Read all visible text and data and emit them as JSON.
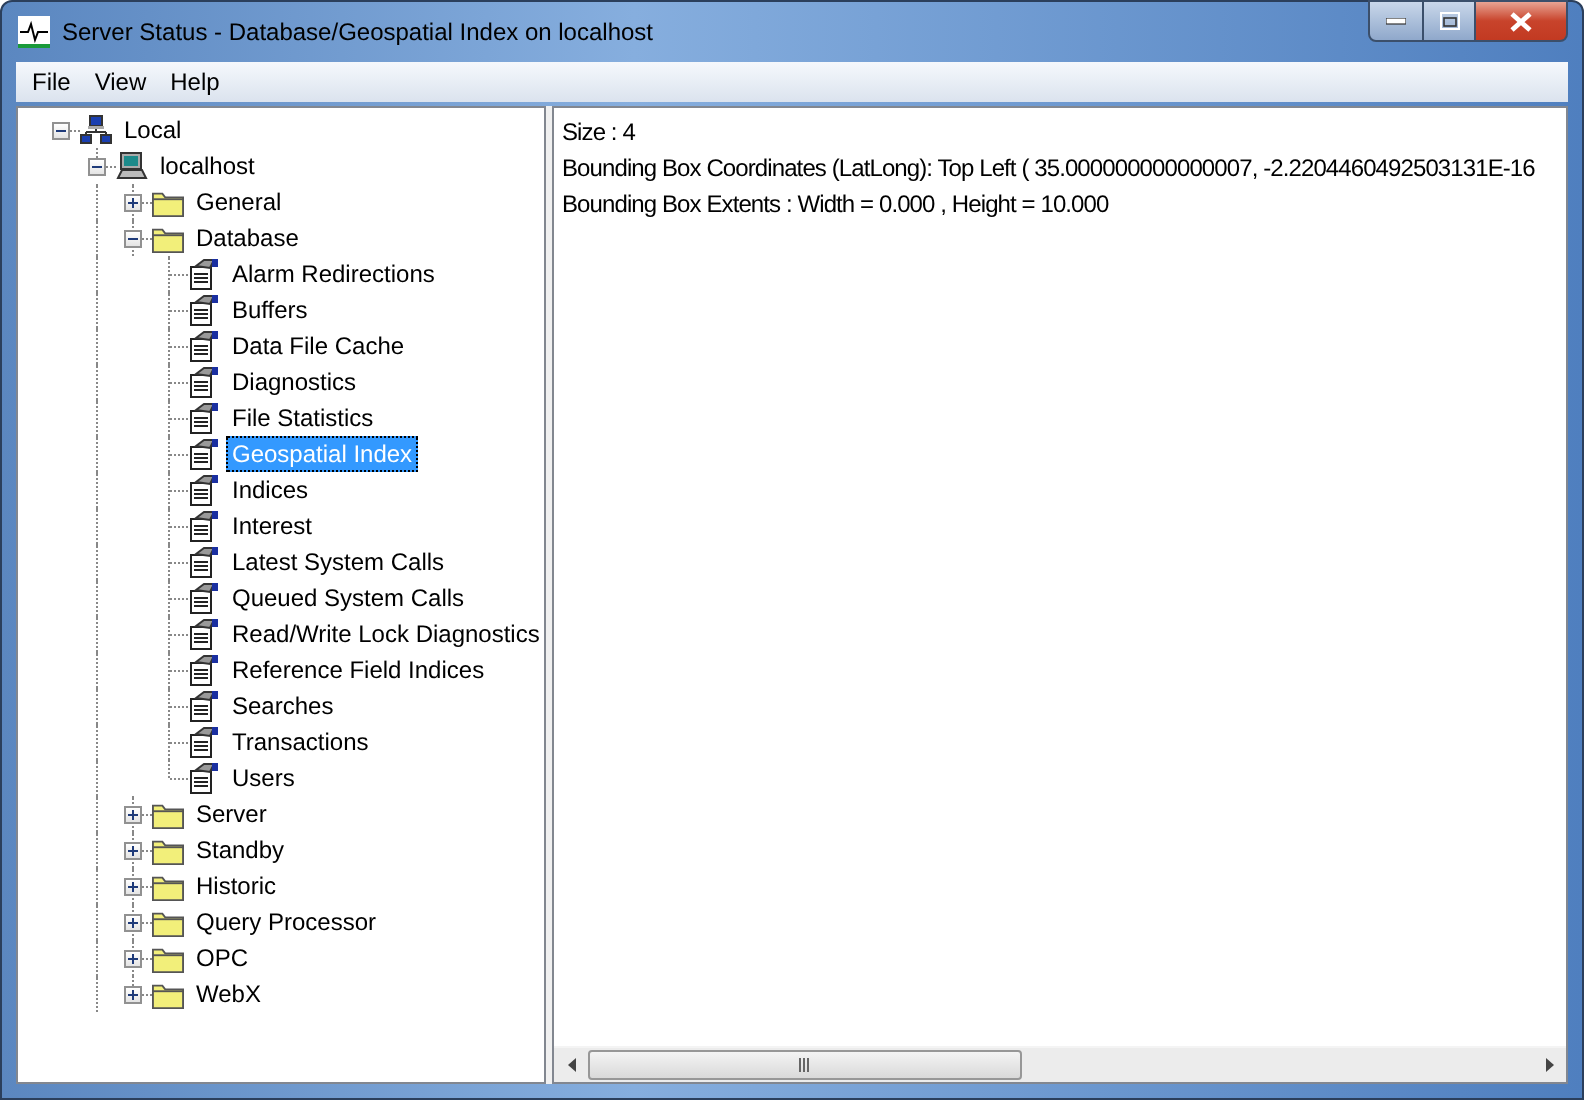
{
  "window": {
    "title": "Server Status - Database/Geospatial Index on localhost"
  },
  "menu": [
    {
      "label": "File"
    },
    {
      "label": "View"
    },
    {
      "label": "Help"
    }
  ],
  "tree": [
    {
      "label": "Local",
      "kind": "network",
      "expanded": true,
      "selected": false,
      "children": [
        {
          "label": "localhost",
          "kind": "computer",
          "expanded": true,
          "selected": false,
          "children": [
            {
              "label": "General",
              "kind": "folder",
              "expanded": false,
              "selected": false
            },
            {
              "label": "Database",
              "kind": "folder",
              "expanded": true,
              "selected": false,
              "children": [
                {
                  "label": "Alarm Redirections",
                  "kind": "page",
                  "selected": false
                },
                {
                  "label": "Buffers",
                  "kind": "page",
                  "selected": false
                },
                {
                  "label": "Data File Cache",
                  "kind": "page",
                  "selected": false
                },
                {
                  "label": "Diagnostics",
                  "kind": "page",
                  "selected": false
                },
                {
                  "label": "File Statistics",
                  "kind": "page",
                  "selected": false
                },
                {
                  "label": "Geospatial Index",
                  "kind": "page",
                  "selected": true
                },
                {
                  "label": "Indices",
                  "kind": "page",
                  "selected": false
                },
                {
                  "label": "Interest",
                  "kind": "page",
                  "selected": false
                },
                {
                  "label": "Latest System Calls",
                  "kind": "page",
                  "selected": false
                },
                {
                  "label": "Queued System Calls",
                  "kind": "page",
                  "selected": false
                },
                {
                  "label": "Read/Write Lock Diagnostics",
                  "kind": "page",
                  "selected": false
                },
                {
                  "label": "Reference Field Indices",
                  "kind": "page",
                  "selected": false
                },
                {
                  "label": "Searches",
                  "kind": "page",
                  "selected": false
                },
                {
                  "label": "Transactions",
                  "kind": "page",
                  "selected": false
                },
                {
                  "label": "Users",
                  "kind": "page",
                  "selected": false
                }
              ]
            },
            {
              "label": "Server",
              "kind": "folder",
              "expanded": false,
              "selected": false
            },
            {
              "label": "Standby",
              "kind": "folder",
              "expanded": false,
              "selected": false
            },
            {
              "label": "Historic",
              "kind": "folder",
              "expanded": false,
              "selected": false
            },
            {
              "label": "Query Processor",
              "kind": "folder",
              "expanded": false,
              "selected": false
            },
            {
              "label": "OPC",
              "kind": "folder",
              "expanded": false,
              "selected": false
            },
            {
              "label": "WebX",
              "kind": "folder",
              "expanded": false,
              "selected": false
            }
          ]
        }
      ]
    }
  ],
  "details": [
    "Size : 4",
    "Bounding Box Coordinates (LatLong): Top Left ( 35.000000000000007, -2.2204460492503131E-16",
    "Bounding Box Extents : Width = 0.000 , Height = 10.000"
  ]
}
